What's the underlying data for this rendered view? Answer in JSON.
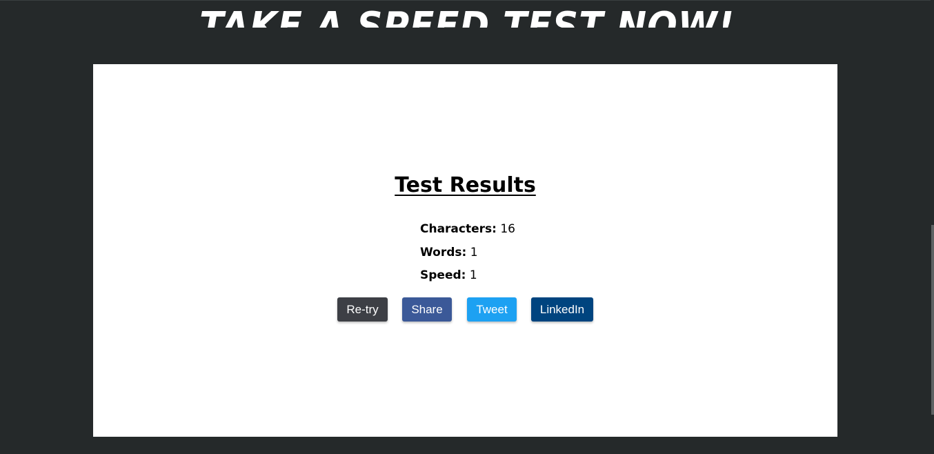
{
  "header": {
    "headline": "Take a speed test now!"
  },
  "results": {
    "title": "Test Results",
    "stats": [
      {
        "label": "Characters:",
        "value": "16"
      },
      {
        "label": "Words:",
        "value": "1"
      },
      {
        "label": "Speed:",
        "value": "1"
      }
    ]
  },
  "buttons": {
    "retry": "Re-try",
    "share": "Share",
    "tweet": "Tweet",
    "linkedin": "LinkedIn"
  },
  "colors": {
    "page_background": "#25292a",
    "card_background": "#ffffff",
    "retry": "#3d3f45",
    "share": "#3b5998",
    "tweet": "#1da1f2",
    "linkedin": "#00447f"
  }
}
